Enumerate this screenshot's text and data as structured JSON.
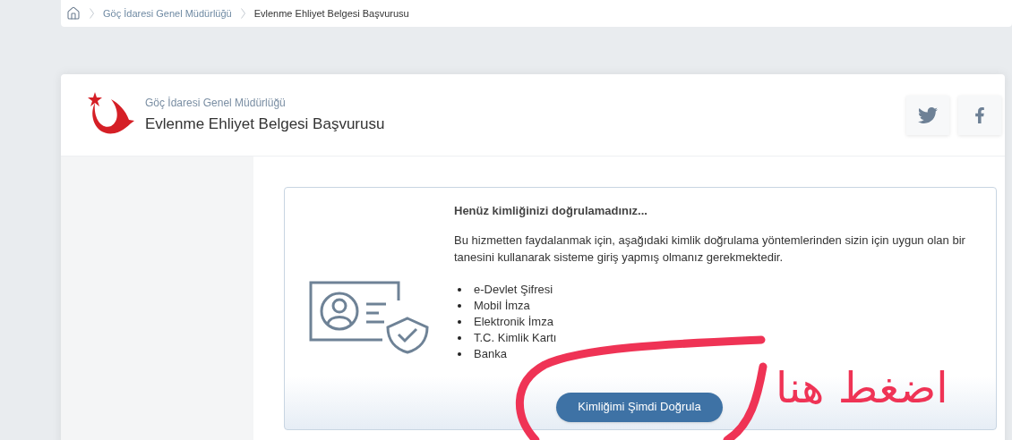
{
  "breadcrumb": [
    {
      "label": "Göç İdaresi Genel Müdürlüğü"
    },
    {
      "label": "Evlenme Ehliyet Belgesi Başvurusu"
    }
  ],
  "header": {
    "org": "Göç İdaresi Genel Müdürlüğü",
    "title": "Evlenme Ehliyet Belgesi Başvurusu"
  },
  "notice": {
    "heading": "Henüz kimliğinizi doğrulamadınız...",
    "body": "Bu hizmetten faydalanmak için, aşağıdaki kimlik doğrulama yöntemlerinden sizin için uygun olan bir tanesini kullanarak sisteme giriş yapmış olmanız gerekmektedir.",
    "methods": [
      "e-Devlet Şifresi",
      "Mobil İmza",
      "Elektronik İmza",
      "T.C. Kimlik Kartı",
      "Banka"
    ],
    "button": "Kimliğimi Şimdi Doğrula"
  },
  "annotation": {
    "text": "اضغط هنا"
  }
}
